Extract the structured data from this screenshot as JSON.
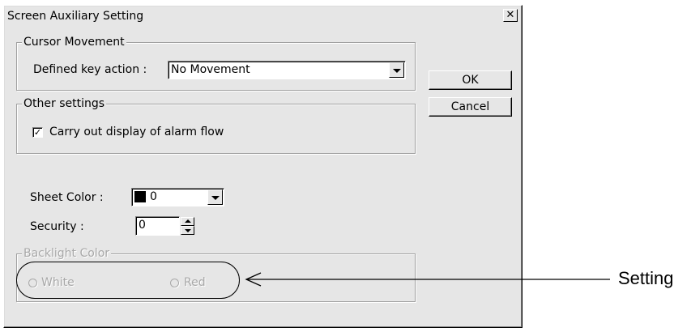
{
  "dialog": {
    "title": "Screen Auxiliary Setting",
    "close_glyph": "✕"
  },
  "cursor_movement": {
    "group_label": "Cursor Movement",
    "key_action_label": "Defined key action :",
    "key_action_value": "No Movement"
  },
  "other_settings": {
    "group_label": "Other settings",
    "alarm_flow_label": "Carry out display of alarm flow",
    "alarm_flow_checked": true,
    "check_glyph": "✓"
  },
  "buttons": {
    "ok_label": "OK",
    "cancel_label": "Cancel"
  },
  "sheet_color": {
    "label": "Sheet Color :",
    "value": "0",
    "swatch_color": "#000000"
  },
  "security": {
    "label": "Security :",
    "value": "0"
  },
  "backlight_color": {
    "group_label": "Backlight Color",
    "options": [
      "White",
      "Red"
    ],
    "enabled": false
  },
  "annotation": {
    "label": "Setting"
  },
  "icons": {
    "close": "close-icon",
    "dropdown": "chevron-down-icon",
    "spin_up": "arrow-up-icon",
    "spin_down": "arrow-down-icon"
  }
}
